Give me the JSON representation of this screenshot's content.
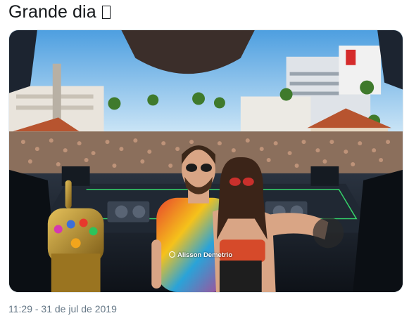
{
  "tweet": {
    "text": "Grande dia",
    "emoji_icon": "missing-glyph-box-icon",
    "timestamp": "11:29 - 31 de jul de 2019"
  },
  "media": {
    "type": "photo",
    "watermark": "Alisson Demetrio"
  },
  "colors": {
    "text_primary": "#14171a",
    "text_secondary": "#657786",
    "sky_top": "#5aa8e6",
    "sky_bottom": "#cfe6f7"
  }
}
